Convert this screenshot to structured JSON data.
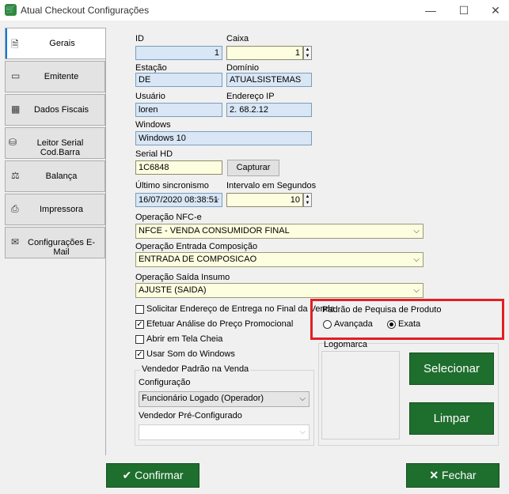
{
  "window": {
    "title": "Atual Checkout Configurações",
    "minimize": "—",
    "maximize": "☐",
    "close": "✕"
  },
  "tabs": [
    {
      "label": "Gerais",
      "icon": "document-icon"
    },
    {
      "label": "Emitente",
      "icon": "card-icon"
    },
    {
      "label": "Dados Fiscais",
      "icon": "calculator-icon"
    },
    {
      "label": "Leitor Serial Cod.Barra",
      "icon": "barcode-reader-icon"
    },
    {
      "label": "Balança",
      "icon": "scale-icon"
    },
    {
      "label": "Impressora",
      "icon": "printer-icon"
    },
    {
      "label": "Configurações E-Mail",
      "icon": "email-icon"
    }
  ],
  "form": {
    "id_label": "ID",
    "id_value": "1",
    "caixa_label": "Caixa",
    "caixa_value": "1",
    "estacao_label": "Estação",
    "estacao_value": "DE",
    "dominio_label": "Domínio",
    "dominio_value": "ATUALSISTEMAS",
    "usuario_label": "Usuário",
    "usuario_value": "loren",
    "ip_label": "Endereço IP",
    "ip_value": "2.  68.2.12",
    "windows_label": "Windows",
    "windows_value": "Windows 10",
    "serialhd_label": "Serial HD",
    "serialhd_value": "1C6848",
    "capturar_label": "Capturar",
    "ultimo_label": "Último sincronismo",
    "ultimo_value": "16/07/2020 08:38:51",
    "intervalo_label": "Intervalo em Segundos",
    "intervalo_value": "10",
    "nfce_label": "Operação NFC-e",
    "nfce_value": "NFCE - VENDA CONSUMIDOR FINAL",
    "entrada_label": "Operação Entrada Composição",
    "entrada_value": "ENTRADA DE COMPOSICAO",
    "saida_label": "Operação Saída Insumo",
    "saida_value": "AJUSTE (SAIDA)"
  },
  "checkboxes": [
    {
      "label": "Solicitar Endereço de Entrega no Final da Venda",
      "checked": false
    },
    {
      "label": "Efetuar Análise do Preço Promocional",
      "checked": true
    },
    {
      "label": "Abrir em Tela Cheia",
      "checked": false
    },
    {
      "label": "Usar Som do Windows",
      "checked": true
    }
  ],
  "padrao": {
    "title": "Padrão de Pequisa de Produto",
    "opt1": "Avançada",
    "opt2": "Exata",
    "selected": "Exata"
  },
  "vendedor": {
    "title": "Vendedor Padrão na Venda",
    "config_label": "Configuração",
    "config_value": "Funcionário Logado (Operador)",
    "pre_label": "Vendedor Pré-Configurado",
    "pre_value": ""
  },
  "logomarca": {
    "label": "Logomarca",
    "select_btn": "Selecionar",
    "clear_btn": "Limpar"
  },
  "footer": {
    "confirm": "Confirmar",
    "close": "Fechar"
  },
  "colors": {
    "accent_green": "#1e6e2d",
    "highlight_red": "#e31e24",
    "field_blue": "#d8e6f5",
    "field_yellow": "#fdfde0"
  }
}
